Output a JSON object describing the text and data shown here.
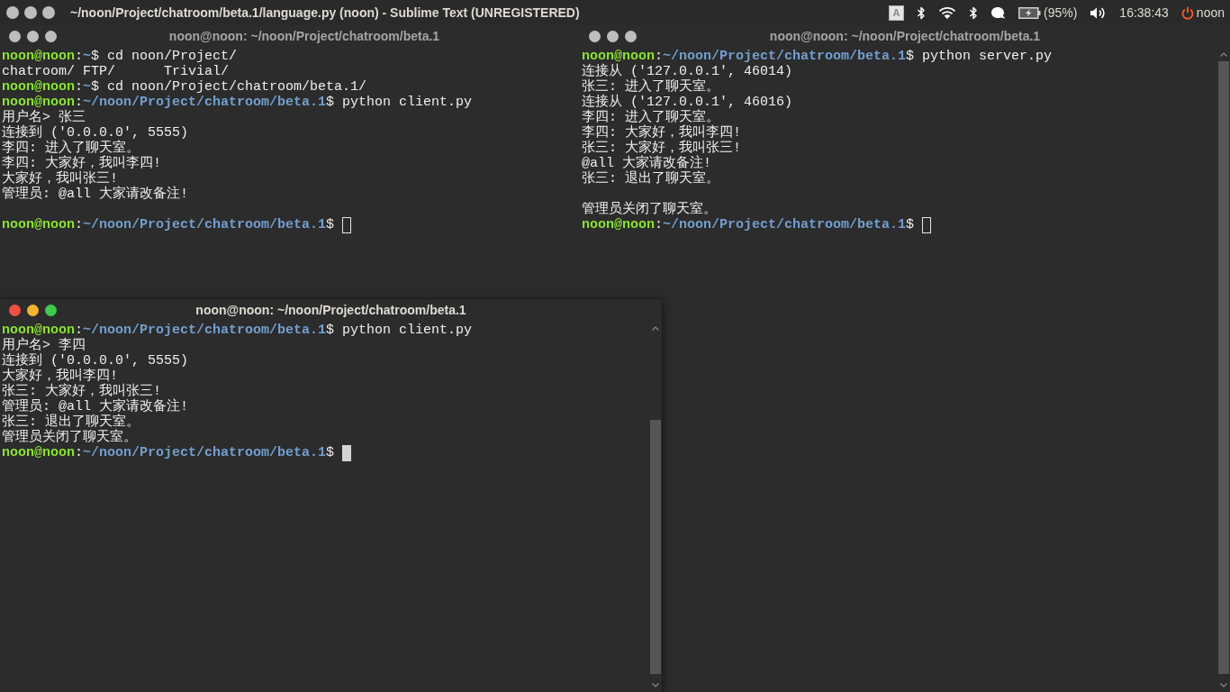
{
  "top_panel": {
    "title": "~/noon/Project/chatroom/beta.1/language.py (noon) - Sublime Text (UNREGISTERED)",
    "keyboard_layout": "A",
    "battery": "(95%)",
    "clock": "16:38:43",
    "user": "noon"
  },
  "windows": [
    {
      "title": "noon@noon: ~/noon/Project/chatroom/beta.1",
      "focused": false,
      "lines": [
        {
          "kind": "prompt",
          "user": "noon@noon",
          "separator": ":",
          "path": "~",
          "symbol": "$",
          "command": "cd noon/Project/",
          "cursor": false
        },
        {
          "kind": "output",
          "text": "chatroom/ FTP/      Trivial/"
        },
        {
          "kind": "prompt",
          "user": "noon@noon",
          "separator": ":",
          "path": "~",
          "symbol": "$",
          "command": "cd noon/Project/chatroom/beta.1/",
          "cursor": false
        },
        {
          "kind": "prompt",
          "user": "noon@noon",
          "separator": ":",
          "path": "~/noon/Project/chatroom/beta.1",
          "symbol": "$",
          "command": "python client.py",
          "cursor": false
        },
        {
          "kind": "output",
          "text": "用户名> 张三"
        },
        {
          "kind": "output",
          "text": "连接到 ('0.0.0.0', 5555)"
        },
        {
          "kind": "output",
          "text": "李四: 进入了聊天室。"
        },
        {
          "kind": "output",
          "text": "李四: 大家好，我叫李四!"
        },
        {
          "kind": "output",
          "text": "大家好，我叫张三!"
        },
        {
          "kind": "output",
          "text": "管理员: @all 大家请改备注!"
        },
        {
          "kind": "blank"
        },
        {
          "kind": "prompt",
          "user": "noon@noon",
          "separator": ":",
          "path": "~/noon/Project/chatroom/beta.1",
          "symbol": "$",
          "cursor": true
        }
      ]
    },
    {
      "title": "noon@noon: ~/noon/Project/chatroom/beta.1",
      "focused": false,
      "lines": [
        {
          "kind": "prompt",
          "user": "noon@noon",
          "separator": ":",
          "path": "~/noon/Project/chatroom/beta.1",
          "symbol": "$",
          "command": "python server.py",
          "cursor": false
        },
        {
          "kind": "output",
          "text": "连接从 ('127.0.0.1', 46014)"
        },
        {
          "kind": "output",
          "text": "张三: 进入了聊天室。"
        },
        {
          "kind": "output",
          "text": "连接从 ('127.0.0.1', 46016)"
        },
        {
          "kind": "output",
          "text": "李四: 进入了聊天室。"
        },
        {
          "kind": "output",
          "text": "李四: 大家好，我叫李四!"
        },
        {
          "kind": "output",
          "text": "张三: 大家好，我叫张三!"
        },
        {
          "kind": "output",
          "text": "@all 大家请改备注!"
        },
        {
          "kind": "output",
          "text": "张三: 退出了聊天室。"
        },
        {
          "kind": "blank"
        },
        {
          "kind": "output",
          "text": "管理员关闭了聊天室。"
        },
        {
          "kind": "prompt",
          "user": "noon@noon",
          "separator": ":",
          "path": "~/noon/Project/chatroom/beta.1",
          "symbol": "$",
          "cursor": true
        }
      ]
    },
    {
      "title": "noon@noon: ~/noon/Project/chatroom/beta.1",
      "focused": true,
      "lines": [
        {
          "kind": "prompt",
          "user": "noon@noon",
          "separator": ":",
          "path": "~/noon/Project/chatroom/beta.1",
          "symbol": "$",
          "command": "python client.py",
          "cursor": false
        },
        {
          "kind": "output",
          "text": "用户名> 李四"
        },
        {
          "kind": "output",
          "text": "连接到 ('0.0.0.0', 5555)"
        },
        {
          "kind": "output",
          "text": "大家好，我叫李四!"
        },
        {
          "kind": "output",
          "text": "张三: 大家好，我叫张三!"
        },
        {
          "kind": "output",
          "text": "管理员: @all 大家请改备注!"
        },
        {
          "kind": "output",
          "text": "张三: 退出了聊天室。"
        },
        {
          "kind": "output",
          "text": "管理员关闭了聊天室。"
        },
        {
          "kind": "prompt",
          "user": "noon@noon",
          "separator": ":",
          "path": "~/noon/Project/chatroom/beta.1",
          "symbol": "$",
          "cursor": true
        }
      ]
    }
  ]
}
